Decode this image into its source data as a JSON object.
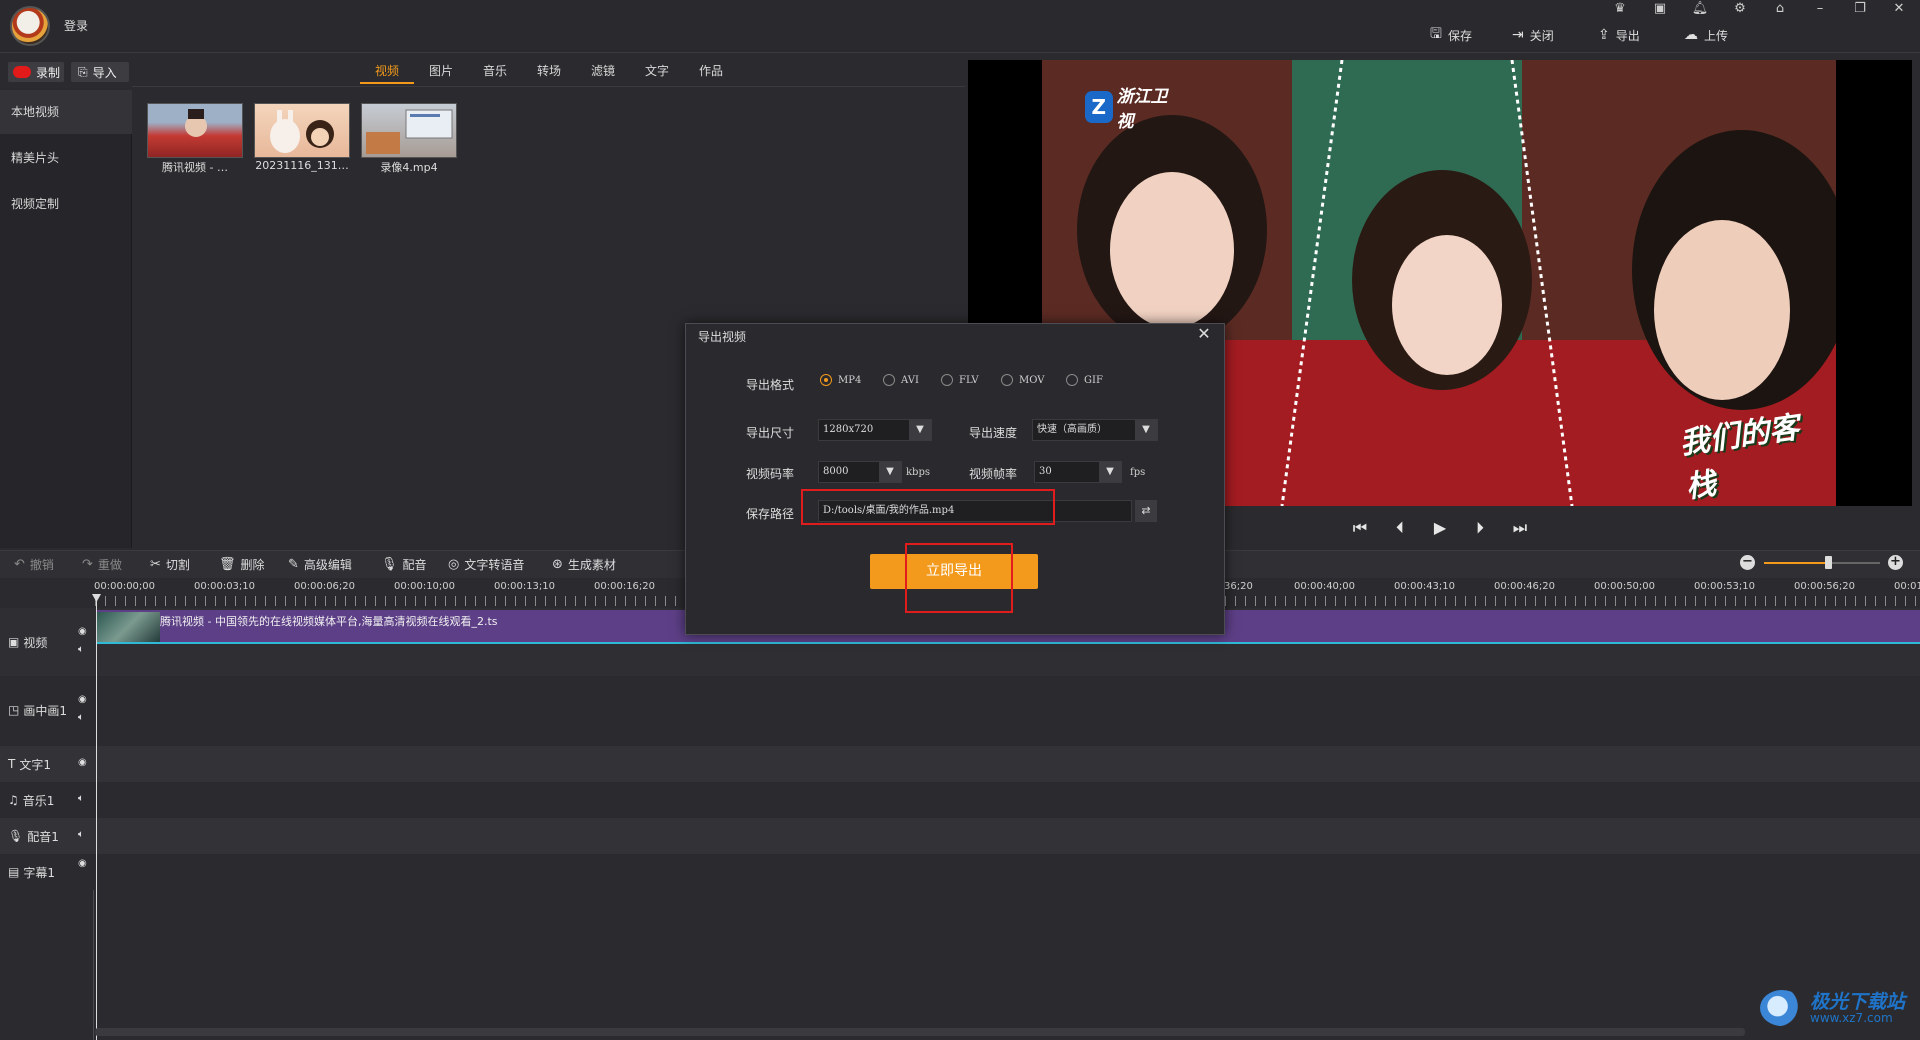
{
  "header": {
    "login_label": "登录",
    "top_icons": [
      "crown-icon",
      "play-window-icon",
      "bell-icon",
      "gear-icon",
      "home-icon",
      "minimize-icon",
      "restore-icon",
      "close-icon"
    ],
    "actions": {
      "save": "保存",
      "close": "关闭",
      "export": "导出",
      "upload": "上传"
    }
  },
  "media": {
    "record_label": "录制",
    "import_label": "导入",
    "sidebar": [
      "本地视频",
      "精美片头",
      "视频定制"
    ],
    "tabs": [
      "视频",
      "图片",
      "音乐",
      "转场",
      "滤镜",
      "文字",
      "作品"
    ],
    "active_tab": "视频",
    "thumbnails": [
      "腾讯视频 - …",
      "20231116_131…",
      "录像4.mp4"
    ]
  },
  "preview": {
    "channel_logo": "浙江卫视",
    "show_logo": "我们的客栈"
  },
  "toolbar": {
    "undo": "撤销",
    "redo": "重做",
    "cut": "切割",
    "delete": "删除",
    "advanced_edit": "高级编辑",
    "dub": "配音",
    "tts": "文字转语音",
    "generate": "生成素材"
  },
  "zoom": {
    "level": 0.55
  },
  "ruler": {
    "labels": [
      "00:00:00;00",
      "00:00:03;10",
      "00:00:06;20",
      "00:00:10;00",
      "00:00:13;10",
      "00:00:16;20",
      "36;20",
      "00:00:40;00",
      "00:00:43;10",
      "00:00:46;20",
      "00:00:50;00",
      "00:00:53;10",
      "00:00:56;20",
      "00:01"
    ]
  },
  "tracks": {
    "video": "视频",
    "pip": "画中画1",
    "text": "文字1",
    "music": "音乐1",
    "voice": "配音1",
    "subtitle": "字幕1",
    "clip_title": "腾讯视频 - 中国领先的在线视频媒体平台,海量高清视频在线观看_2.ts"
  },
  "dialog": {
    "title": "导出视频",
    "format_label": "导出格式",
    "formats": [
      "MP4",
      "AVI",
      "FLV",
      "MOV",
      "GIF"
    ],
    "selected_format": "MP4",
    "size_label": "导出尺寸",
    "size_value": "1280x720",
    "speed_label": "导出速度",
    "speed_value": "快速（高画质）",
    "bitrate_label": "视频码率",
    "bitrate_value": "8000",
    "bitrate_unit": "kbps",
    "framerate_label": "视频帧率",
    "framerate_value": "30",
    "framerate_unit": "fps",
    "path_label": "保存路径",
    "path_value": "D:/tools/桌面/我的作品.mp4",
    "export_now": "立即导出"
  },
  "watermark": {
    "main": "极光下载站",
    "sub": "www.xz7.com"
  },
  "colors": {
    "accent": "#f39a1c",
    "clip": "#5d3f87",
    "highlight": "#e11c1c"
  }
}
